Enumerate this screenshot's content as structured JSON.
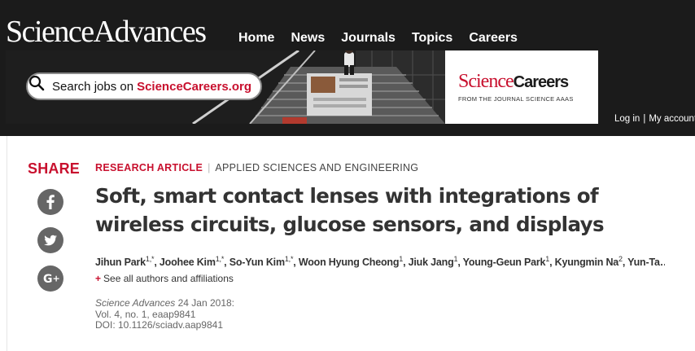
{
  "header": {
    "brand": "ScienceAdvances",
    "nav": [
      "Home",
      "News",
      "Journals",
      "Topics",
      "Careers"
    ],
    "account": {
      "login": "Log in",
      "separator": "|",
      "my_account": "My account"
    }
  },
  "banner": {
    "search_text": "Search jobs on",
    "search_site": "ScienceCareers.org",
    "careers_logo": {
      "science": "Science",
      "careers": "Careers",
      "tagline": "FROM THE JOURNAL SCIENCE  AAAS"
    }
  },
  "share": {
    "label": "SHARE",
    "buttons": [
      "facebook",
      "twitter",
      "google-plus"
    ]
  },
  "article": {
    "type": "RESEARCH ARTICLE",
    "subject": "APPLIED SCIENCES AND ENGINEERING",
    "title": "Soft, smart contact lenses with integrations of wireless circuits, glucose sensors, and displays",
    "authors": [
      {
        "name": "Jihun Park",
        "sup": "1,*"
      },
      {
        "name": "Joohee Kim",
        "sup": "1,*"
      },
      {
        "name": "So-Yun Kim",
        "sup": "1,*"
      },
      {
        "name": "Woon Hyung Cheong",
        "sup": "1"
      },
      {
        "name": "Jiuk Jang",
        "sup": "1"
      },
      {
        "name": "Young-Geun Park",
        "sup": "1"
      },
      {
        "name": "Kyungmin Na",
        "sup": "2"
      },
      {
        "name": "Yun-Ta…",
        "sup": ""
      }
    ],
    "see_all": "See all authors and affiliations",
    "citation": {
      "journal": "Science Advances",
      "date": "24 Jan 2018:",
      "volume": "Vol. 4, no. 1, eaap9841",
      "doi": "DOI: 10.1126/sciadv.aap9841"
    }
  },
  "colors": {
    "brand_red": "#c8102e",
    "header_bg": "#1b1b1b",
    "icon_gray": "#666666"
  }
}
